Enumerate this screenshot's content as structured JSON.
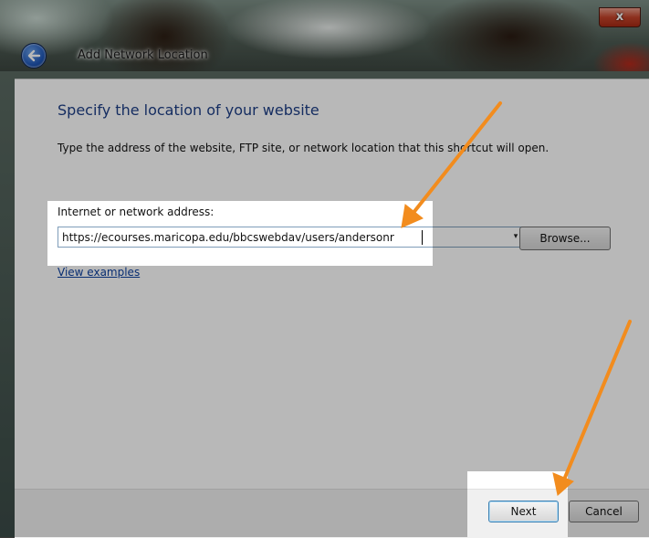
{
  "window": {
    "title": "Add Network Location",
    "close_label": "x"
  },
  "content": {
    "heading": "Specify the location of your website",
    "description": "Type the address of the website, FTP site, or network location that this shortcut will open.",
    "address": {
      "label": "Internet or network address:",
      "value": "https://ecourses.maricopa.edu/bbcswebdav/users/andersonr",
      "dropdown_glyph": "▾"
    },
    "browse_label": "Browse...",
    "view_examples_label": "View examples"
  },
  "footer": {
    "next_label": "Next",
    "cancel_label": "Cancel"
  },
  "annotations": {
    "arrow_color": "#f28c1e",
    "highlight_color": "#ffffff"
  }
}
